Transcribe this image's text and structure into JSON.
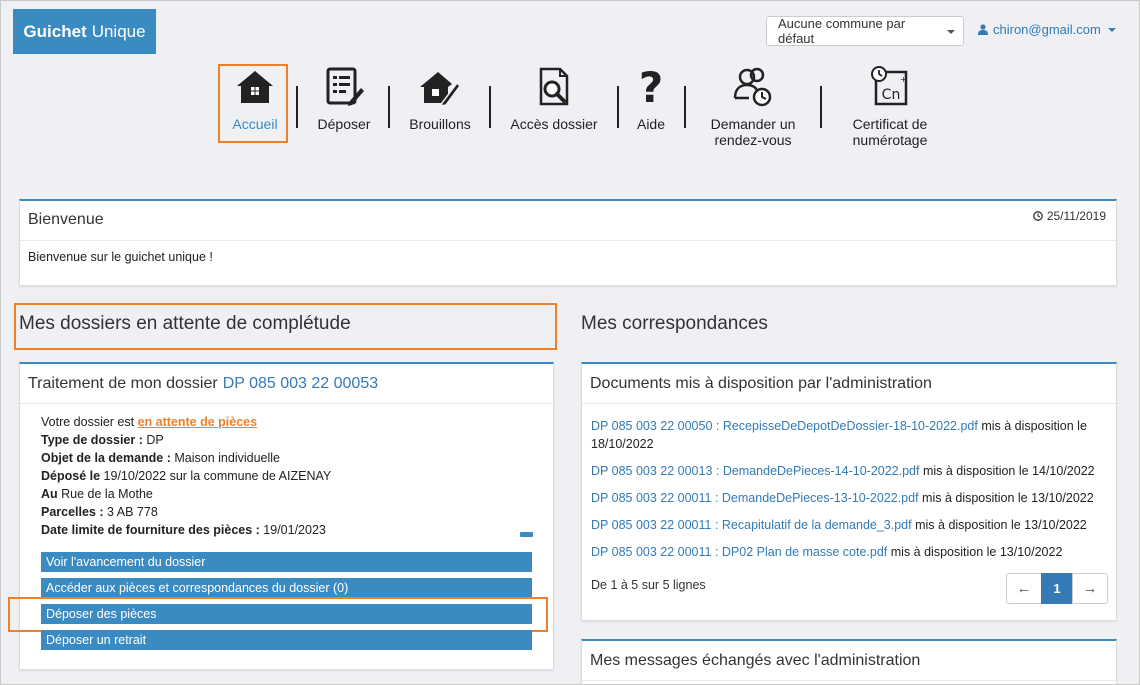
{
  "header": {
    "brand_bold": "Guichet",
    "brand_rest": "Unique",
    "commune_select": "Aucune commune par défaut",
    "user_email": "chiron@gmail.com"
  },
  "nav": {
    "accueil": "Accueil",
    "deposer": "Déposer",
    "brouillons": "Brouillons",
    "acces_dossier": "Accès dossier",
    "aide": "Aide",
    "rdv_line1": "Demander un",
    "rdv_line2": "rendez-vous",
    "cert_line1": "Certificat de",
    "cert_line2": "numérotage",
    "cert_icon_text": "Cn"
  },
  "welcome": {
    "title": "Bienvenue",
    "date": "25/11/2019",
    "message": "Bienvenue sur le guichet unique !"
  },
  "pending": {
    "section_title": "Mes dossiers en attente de complétude",
    "panel_title_prefix": "Traitement de mon dossier",
    "dossier_number": "DP 085 003 22 00053",
    "status_prefix": "Votre dossier est",
    "status_link": "en attente de pièces",
    "type_label": "Type de dossier :",
    "type_value": "DP",
    "objet_label": "Objet de la demande :",
    "objet_value": "Maison individuelle",
    "depose_label": "Déposé le",
    "depose_value": "19/10/2022 sur la commune de AIZENAY",
    "au_label": "Au",
    "au_value": "Rue de la Mothe",
    "parcelles_label": "Parcelles :",
    "parcelles_value": "3 AB 778",
    "date_limite_label": "Date limite de fourniture des pièces :",
    "date_limite_value": "19/01/2023",
    "actions": [
      "Voir l'avancement du dossier",
      "Accéder aux pièces et correspondances du dossier (0)",
      "Déposer des pièces",
      "Déposer un retrait"
    ]
  },
  "correspondances": {
    "section_title": "Mes correspondances",
    "documents_title": "Documents mis à disposition par l'administration",
    "documents": [
      {
        "link": "DP 085 003 22 00050 : RecepisseDeDepotDeDossier-18-10-2022.pdf",
        "suffix": "mis à disposition le 18/10/2022"
      },
      {
        "link": "DP 085 003 22 00013 : DemandeDePieces-14-10-2022.pdf",
        "suffix": "mis à disposition le 14/10/2022"
      },
      {
        "link": "DP 085 003 22 00011 : DemandeDePieces-13-10-2022.pdf",
        "suffix": "mis à disposition le 13/10/2022"
      },
      {
        "link": "DP 085 003 22 00011 : Recapitulatif de la demande_3.pdf",
        "suffix": "mis à disposition le 13/10/2022"
      },
      {
        "link": "DP 085 003 22 00011 : DP02 Plan de masse cote.pdf",
        "suffix": "mis à disposition le 13/10/2022"
      }
    ],
    "count_text": "De 1 à 5 sur 5 lignes",
    "pager": {
      "prev": "←",
      "current": "1",
      "next": "→"
    },
    "messages_title": "Mes messages échangés avec l'administration"
  },
  "colors": {
    "accent": "#3a8bc2",
    "highlight": "#f07f2a",
    "link": "#337ab7"
  }
}
